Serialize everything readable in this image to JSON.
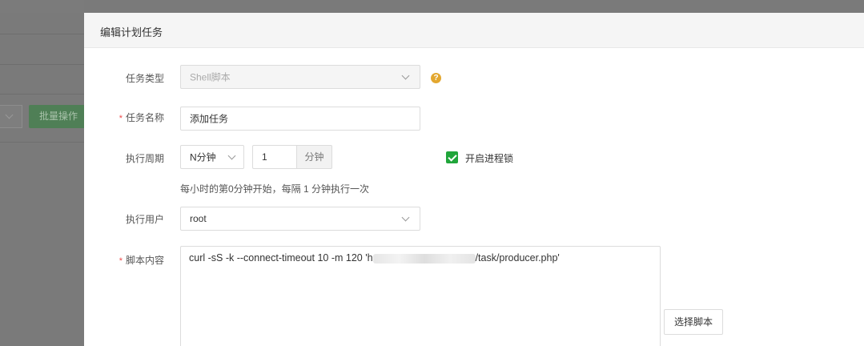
{
  "background": {
    "batch_button_label": "批量操作"
  },
  "dialog": {
    "title": "编辑计划任务",
    "task_type": {
      "label": "任务类型",
      "value": "Shell脚本",
      "help_icon": "question-circle-icon",
      "disabled": true
    },
    "task_name": {
      "label": "任务名称",
      "required": true,
      "value": "添加任务"
    },
    "period": {
      "label": "执行周期",
      "type_value": "N分钟",
      "interval_value": "1",
      "unit": "分钟",
      "lock_checked": true,
      "lock_label": "开启进程锁",
      "hint": "每小时的第0分钟开始，每隔 1 分钟执行一次"
    },
    "user": {
      "label": "执行用户",
      "value": "root"
    },
    "script": {
      "label": "脚本内容",
      "required": true,
      "code_prefix": "curl -sS -k --connect-timeout 10 -m 120 'h",
      "code_suffix": "/task/producer.php'",
      "select_button_label": "选择脚本"
    }
  },
  "colors": {
    "accent": "#20a53a",
    "required_mark": "#ef4c4c",
    "help_icon": "#e3a72f"
  }
}
